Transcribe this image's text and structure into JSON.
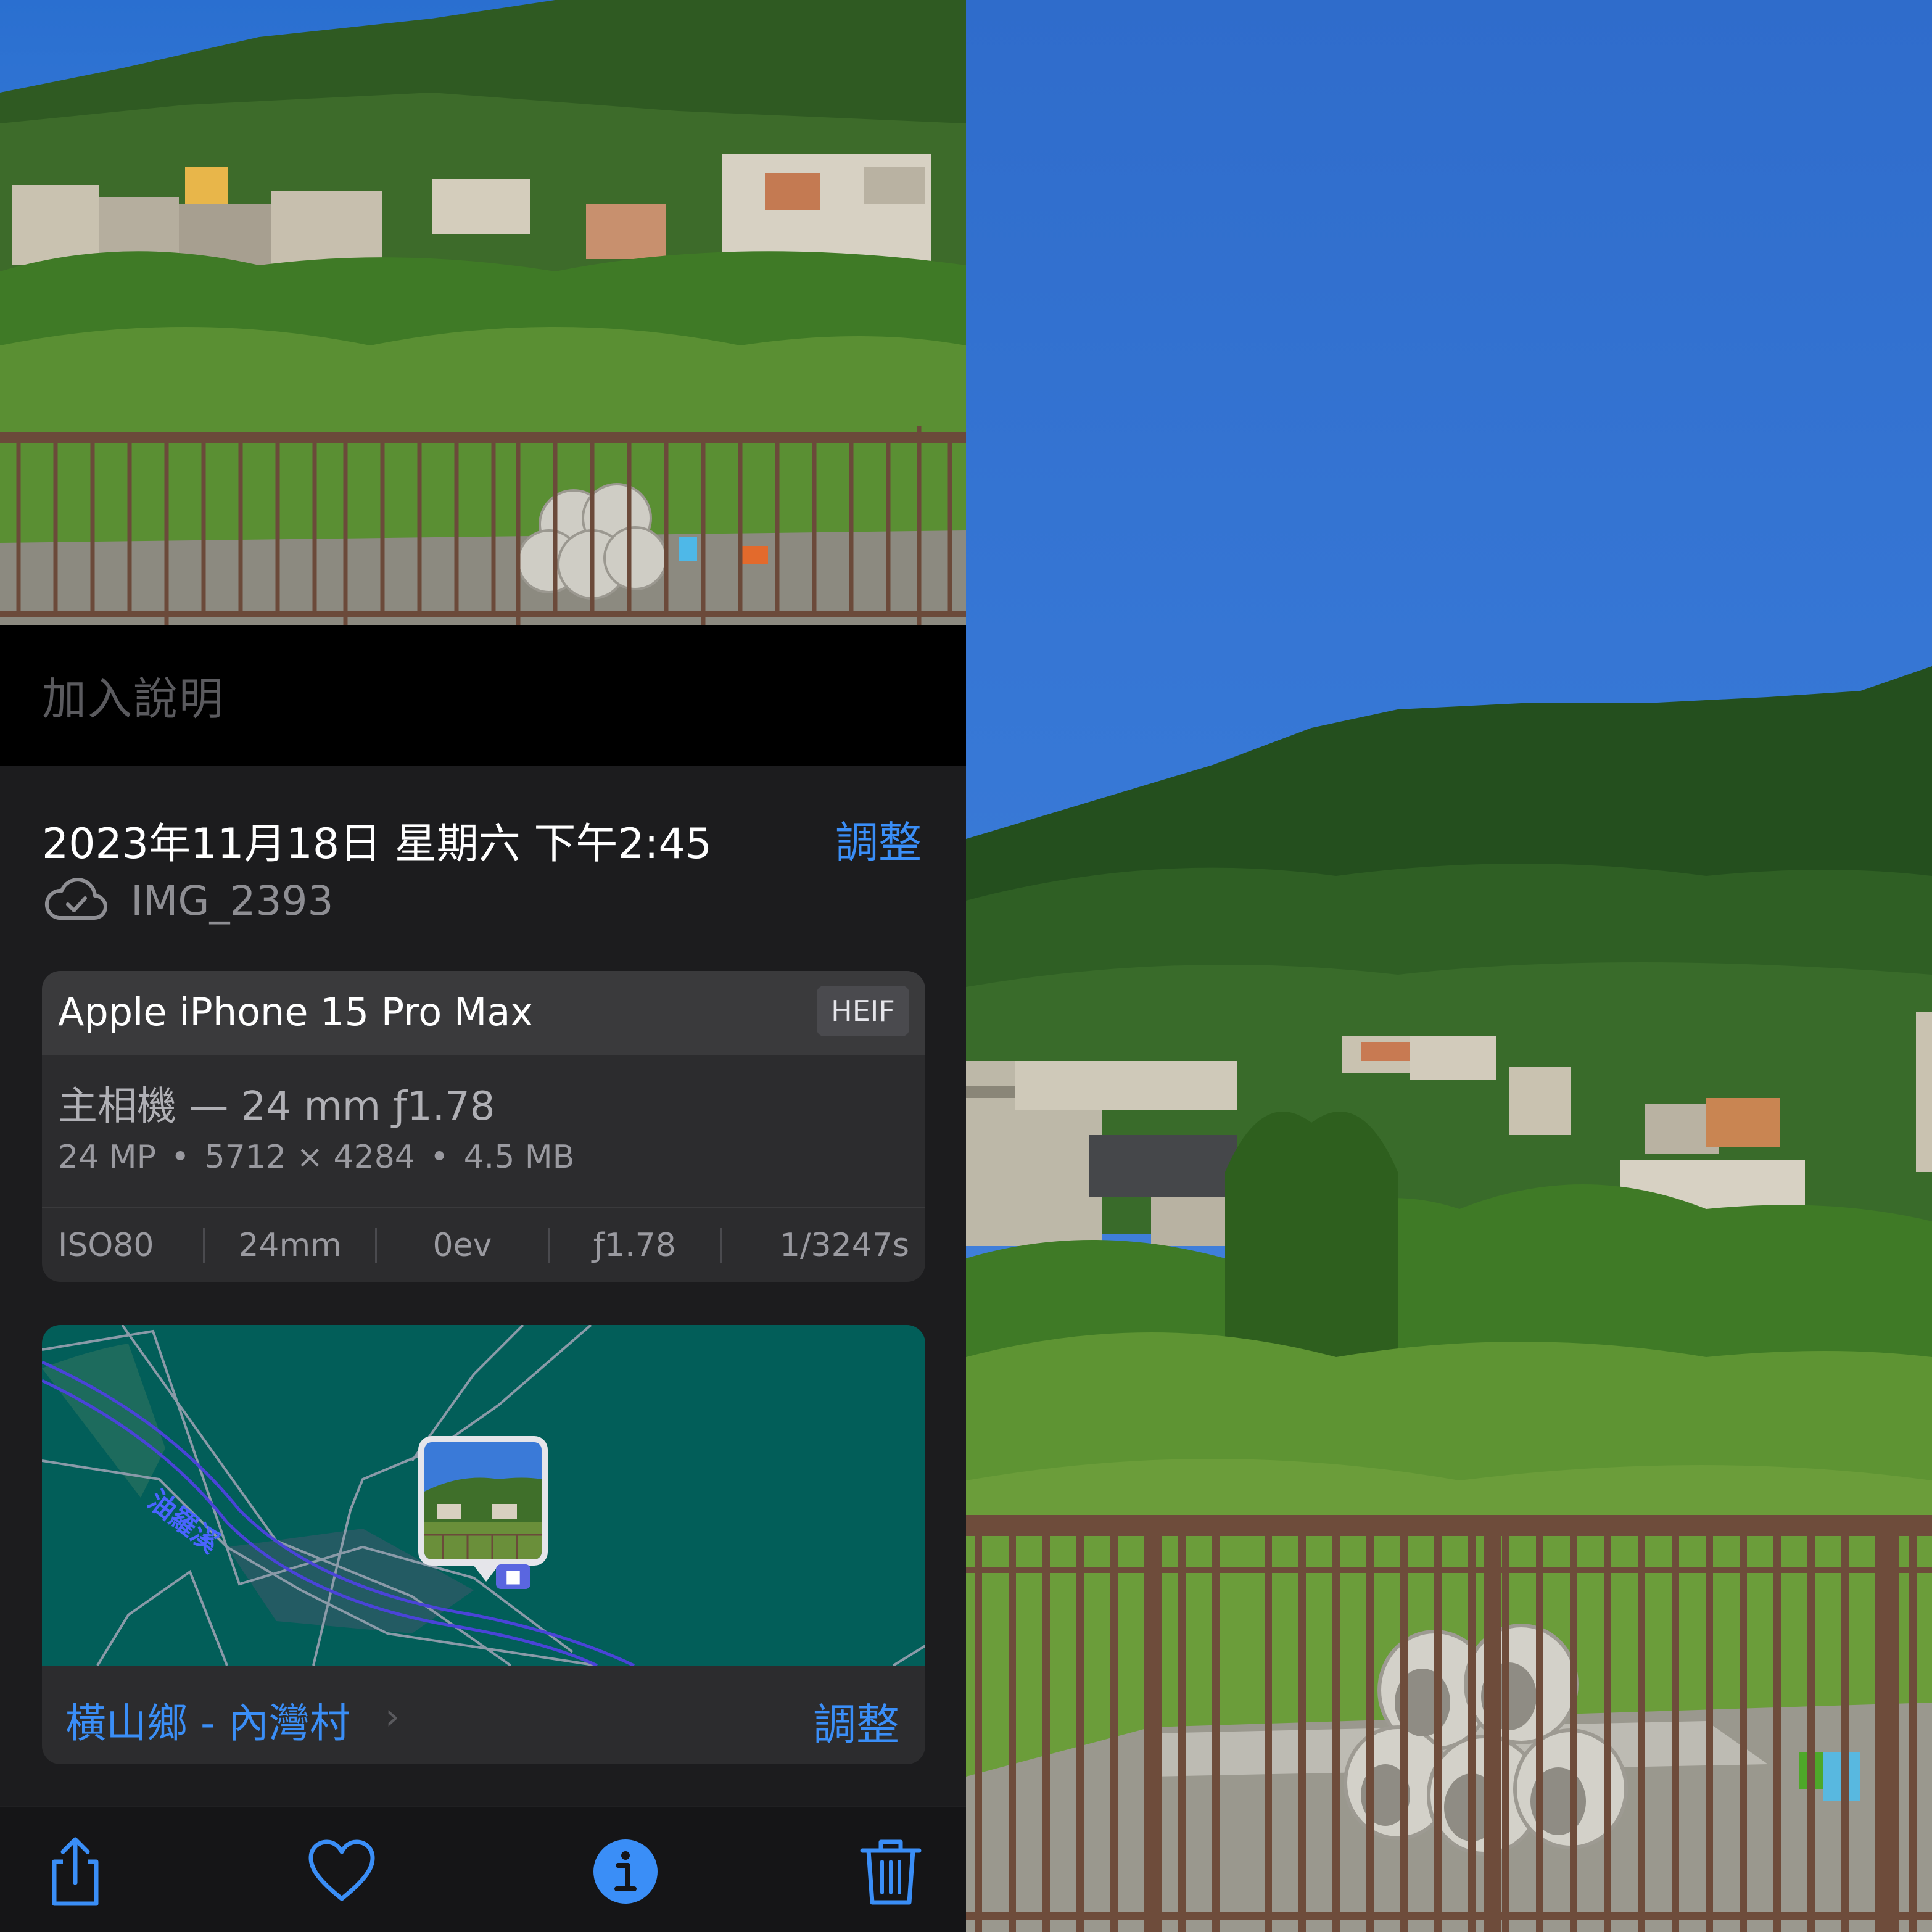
{
  "caption": {
    "placeholder": "加入說明"
  },
  "header": {
    "datetime": "2023年11月18日 星期六 下午2:45",
    "adjust_label": "調整",
    "filename": "IMG_2393"
  },
  "device": {
    "name": "Apple iPhone 15 Pro Max",
    "format": "HEIF",
    "lens": "主相機 — 24 mm ƒ1.78",
    "megapixels": "24 MP",
    "resolution": "5712 × 4284",
    "filesize": "4.5 MB",
    "exif": {
      "iso": "ISO80",
      "focal": "24mm",
      "ev": "0ev",
      "aperture": "ƒ1.78",
      "shutter": "1/3247s"
    }
  },
  "map": {
    "river_label": "油羅溪",
    "location": "橫山鄉 - 內灣村",
    "chevron": "›",
    "adjust_label": "調整"
  },
  "toolbar": {
    "icons": [
      "share-icon",
      "heart-icon",
      "info-icon",
      "trash-icon"
    ]
  },
  "colors": {
    "accent": "#3a8ef7",
    "panel_bg": "#1c1c1e",
    "card_bg": "#2c2c2e",
    "map_bg": "#025e59",
    "sky": "#3a7ad8"
  }
}
